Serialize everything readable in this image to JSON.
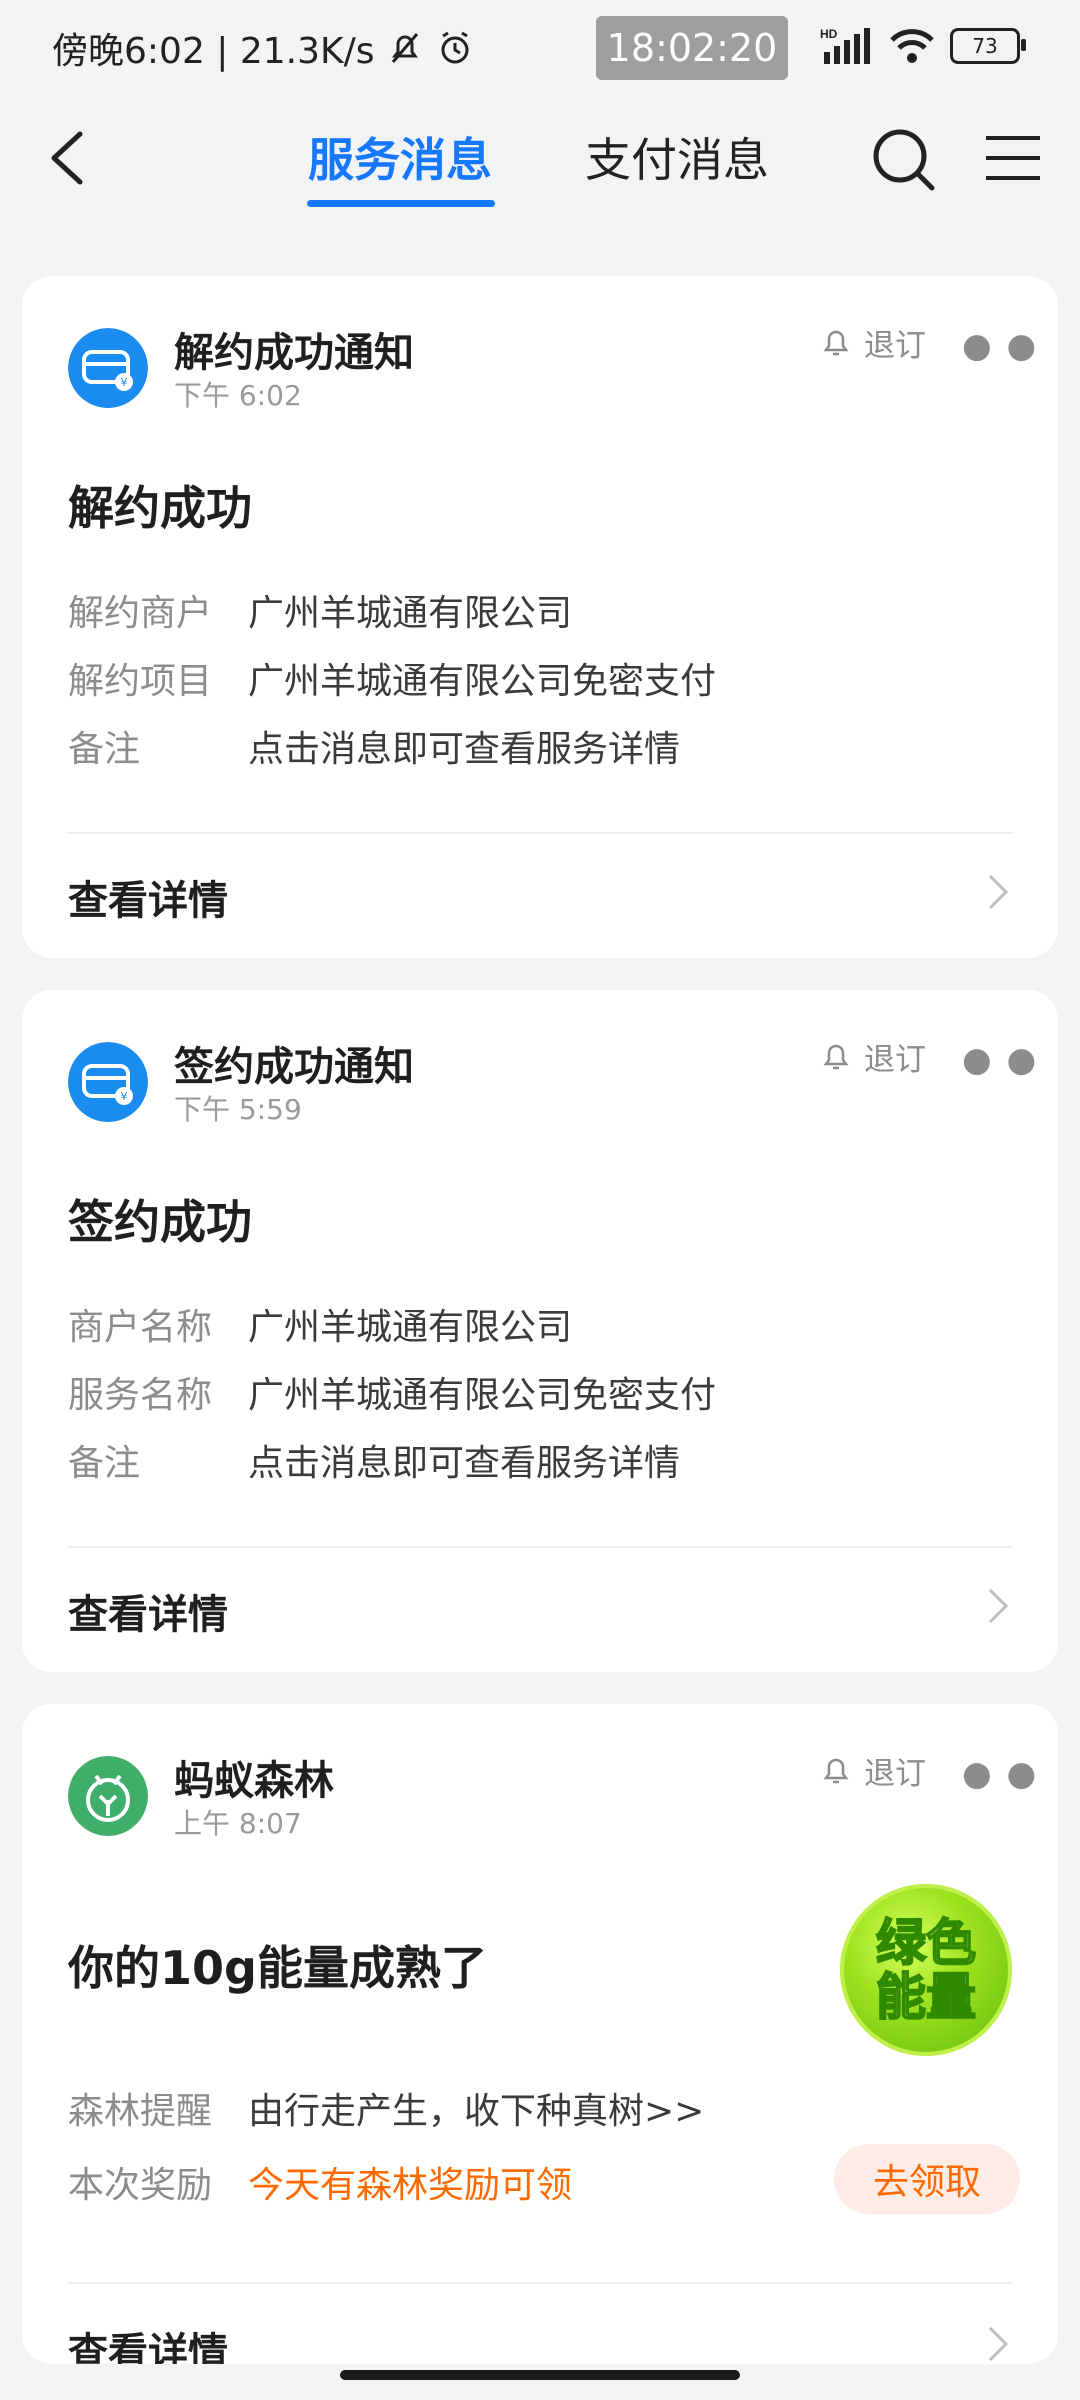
{
  "status_bar": {
    "left_text": "傍晚6:02 | 21.3K/s",
    "center_time": "18:02:20",
    "battery": "73"
  },
  "header": {
    "tabs": [
      {
        "label": "服务消息",
        "active": true
      },
      {
        "label": "支付消息",
        "active": false
      }
    ]
  },
  "cards": [
    {
      "title": "解约成功通知",
      "time": "下午 6:02",
      "unsubscribe": "退订",
      "headline": "解约成功",
      "rows": [
        {
          "k": "解约商户",
          "v": "广州羊城通有限公司"
        },
        {
          "k": "解约项目",
          "v": "广州羊城通有限公司免密支付"
        },
        {
          "k": "备注",
          "v": "点击消息即可查看服务详情"
        }
      ],
      "detail": "查看详情"
    },
    {
      "title": "签约成功通知",
      "time": "下午 5:59",
      "unsubscribe": "退订",
      "headline": "签约成功",
      "rows": [
        {
          "k": "商户名称",
          "v": "广州羊城通有限公司"
        },
        {
          "k": "服务名称",
          "v": "广州羊城通有限公司免密支付"
        },
        {
          "k": "备注",
          "v": "点击消息即可查看服务详情"
        }
      ],
      "detail": "查看详情"
    },
    {
      "title": "蚂蚁森林",
      "time": "上午 8:07",
      "unsubscribe": "退订",
      "headline": "你的10g能量成熟了",
      "energy_badge": [
        "绿色",
        "能量"
      ],
      "rows": [
        {
          "k": "森林提醒",
          "v": "由行走产生，收下种真树>>"
        },
        {
          "k": "本次奖励",
          "v": "今天有森林奖励可领"
        }
      ],
      "claim_button": "去领取",
      "detail": "查看详情"
    }
  ],
  "colors": {
    "accent": "#1677ff",
    "orange": "#ff6a00",
    "background": "#f2f3f5"
  }
}
